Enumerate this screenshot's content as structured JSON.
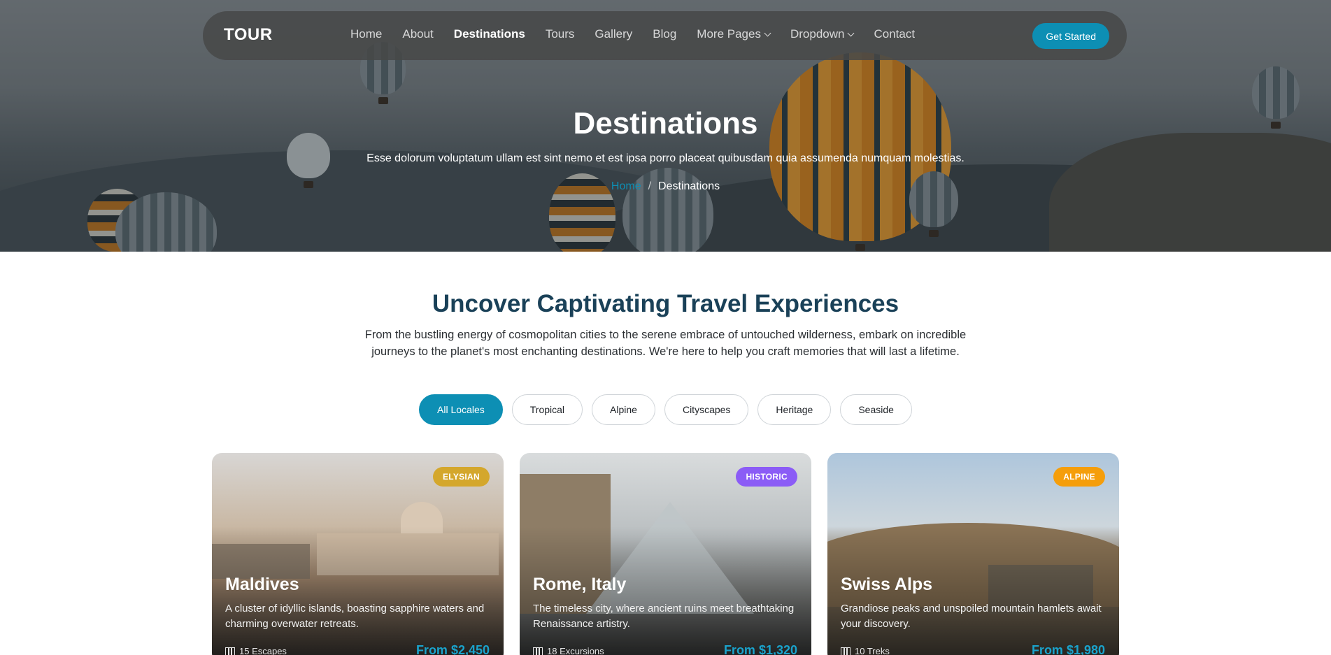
{
  "nav": {
    "logo": "TOUR",
    "items": [
      {
        "label": "Home"
      },
      {
        "label": "About"
      },
      {
        "label": "Destinations"
      },
      {
        "label": "Tours"
      },
      {
        "label": "Gallery"
      },
      {
        "label": "Blog"
      },
      {
        "label": "More Pages"
      },
      {
        "label": "Dropdown"
      },
      {
        "label": "Contact"
      }
    ],
    "active_item": "Destinations",
    "cta_label": "Get Started"
  },
  "hero": {
    "title": "Destinations",
    "subtitle": "Esse dolorum voluptatum ullam est sint nemo et est ipsa porro placeat quibusdam quia assumenda numquam molestias.",
    "breadcrumb": {
      "home": "Home",
      "separator": "/",
      "current": "Destinations"
    }
  },
  "section": {
    "title": "Uncover Captivating Travel Experiences",
    "description": "From the bustling energy of cosmopolitan cities to the serene embrace of untouched wilderness, embark on incredible journeys to the planet's most enchanting destinations. We're here to help you craft memories that will last a lifetime."
  },
  "filters": [
    {
      "label": "All Locales",
      "active": true
    },
    {
      "label": "Tropical",
      "active": false
    },
    {
      "label": "Alpine",
      "active": false
    },
    {
      "label": "Cityscapes",
      "active": false
    },
    {
      "label": "Heritage",
      "active": false
    },
    {
      "label": "Seaside",
      "active": false
    }
  ],
  "cards": [
    {
      "badge": "ELYSIAN",
      "badge_color": "#d4a72c",
      "title": "Maldives",
      "description": "A cluster of idyllic islands, boasting sapphire waters and charming overwater retreats.",
      "meta": "15 Escapes",
      "price": "From $2,450"
    },
    {
      "badge": "HISTORIC",
      "badge_color": "#8b5cf6",
      "title": "Rome, Italy",
      "description": "The timeless city, where ancient ruins meet breathtaking Renaissance artistry.",
      "meta": "18 Excursions",
      "price": "From $1,320"
    },
    {
      "badge": "ALPINE",
      "badge_color": "#f59e0b",
      "title": "Swiss Alps",
      "description": "Grandiose peaks and unspoiled mountain hamlets await your discovery.",
      "meta": "10 Treks",
      "price": "From $1,980"
    }
  ],
  "colors": {
    "accent": "#0d8fb4",
    "heading": "#1a4158"
  }
}
